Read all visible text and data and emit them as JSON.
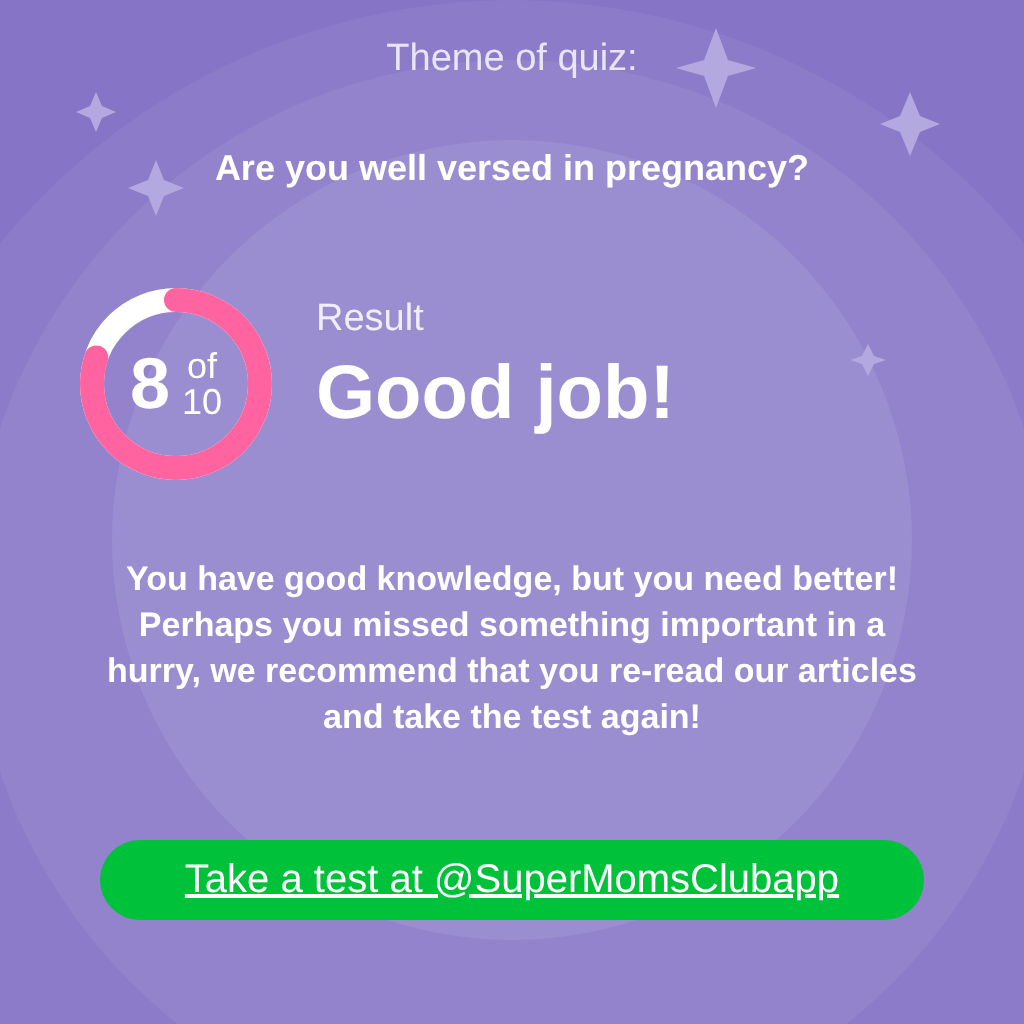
{
  "theme_label": "Theme of quiz:",
  "quiz_title": "Are you well versed in pregnancy?",
  "score": {
    "value": "8",
    "of": "of",
    "total": "10",
    "level": 0.8
  },
  "result": {
    "label": "Result",
    "verdict": "Good job!"
  },
  "message": "You have good knowledge, but you need better! Perhaps you missed something important in a hurry, we recommend that you re-read our articles and take the test again!",
  "cta": {
    "label": "Take a test at @SuperMomsClubapp"
  }
}
